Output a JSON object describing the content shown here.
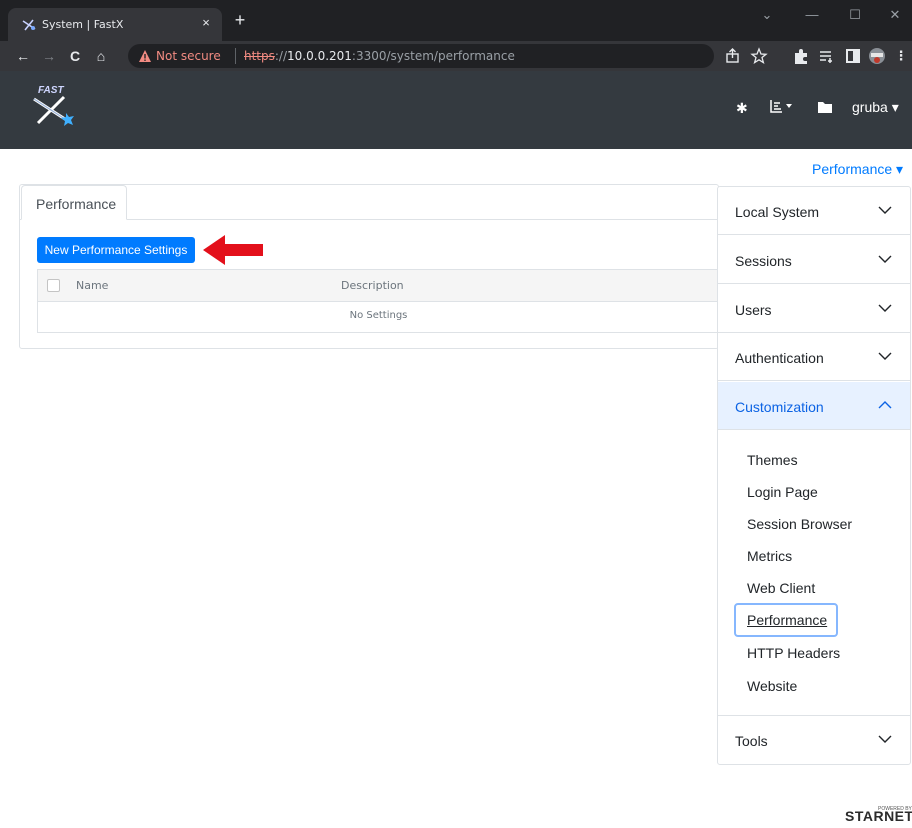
{
  "browser": {
    "tab_title": "System | FastX",
    "tab_close": "×",
    "new_tab": "+",
    "window_controls": {
      "minimize": "—",
      "maximize": "☐",
      "close": "✕",
      "dropdown": "⌄"
    },
    "address": {
      "security_label": "Not secure",
      "url_scheme": "https",
      "url_sep": "://",
      "url_host": "10.0.0.201",
      "url_path": ":3300/system/performance"
    },
    "nav": {
      "back": "←",
      "forward": "→",
      "reload": "C",
      "home": "⌂"
    }
  },
  "app": {
    "brand": "FAST",
    "user_name": "gruba",
    "header_icons": [
      "gear-icon",
      "chart-icon",
      "folder-icon"
    ]
  },
  "page": {
    "section_dropdown": "Performance",
    "tab_label": "Performance",
    "new_button": "New Performance Settings",
    "table": {
      "columns": [
        "Name",
        "Description"
      ],
      "empty_text": "No Settings"
    }
  },
  "sidebar": {
    "sections": [
      {
        "label": "Local System",
        "expanded": false
      },
      {
        "label": "Sessions",
        "expanded": false
      },
      {
        "label": "Users",
        "expanded": false
      },
      {
        "label": "Authentication",
        "expanded": false
      },
      {
        "label": "Customization",
        "expanded": true
      },
      {
        "label": "Tools",
        "expanded": false
      }
    ],
    "customization_items": [
      "Themes",
      "Login Page",
      "Session Browser",
      "Metrics",
      "Web Client",
      "Performance",
      "HTTP Headers",
      "Website"
    ],
    "active_item": "Performance"
  },
  "footer": {
    "powered_by": "POWERED BY",
    "brand": "STARNET"
  },
  "colors": {
    "accent": "#007bff",
    "header_bg": "#343a40",
    "annotation_arrow": "#e3101b"
  }
}
